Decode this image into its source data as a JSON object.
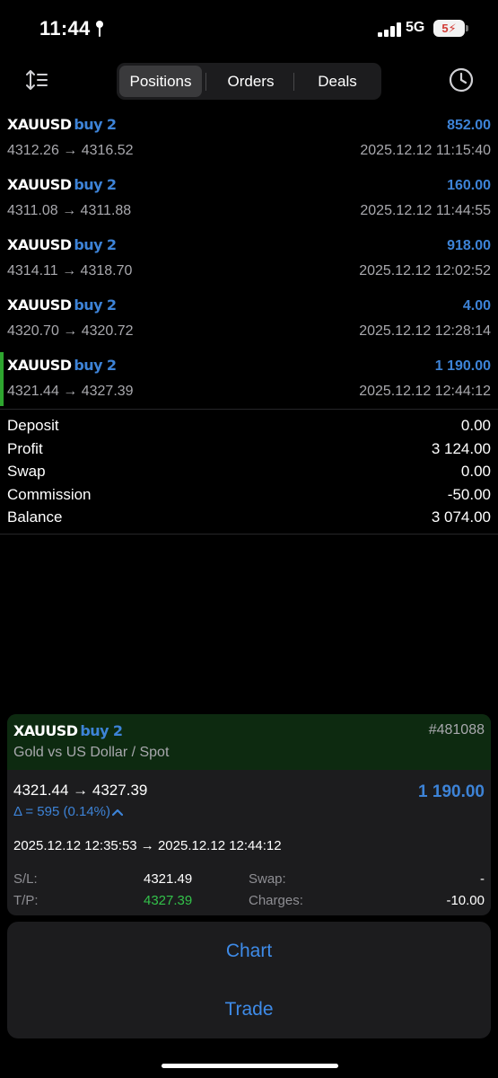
{
  "status_bar": {
    "time": "11:44",
    "network": "5G",
    "battery": "5"
  },
  "tabs": [
    {
      "label": "Positions",
      "active": true
    },
    {
      "label": "Orders",
      "active": false
    },
    {
      "label": "Deals",
      "active": false
    }
  ],
  "positions": [
    {
      "symbol": "XAUUSD",
      "side": "buy 2",
      "prices": "4312.26 → 4316.52",
      "profit": "852.00",
      "time": "2025.12.12 11:15:40"
    },
    {
      "symbol": "XAUUSD",
      "side": "buy 2",
      "prices": "4311.08 → 4311.88",
      "profit": "160.00",
      "time": "2025.12.12 11:44:55"
    },
    {
      "symbol": "XAUUSD",
      "side": "buy 2",
      "prices": "4314.11 → 4318.70",
      "profit": "918.00",
      "time": "2025.12.12 12:02:52"
    },
    {
      "symbol": "XAUUSD",
      "side": "buy 2",
      "prices": "4320.70 → 4320.72",
      "profit": "4.00",
      "time": "2025.12.12 12:28:14"
    },
    {
      "symbol": "XAUUSD",
      "side": "buy 2",
      "prices": "4321.44 → 4327.39",
      "profit": "1 190.00",
      "time": "2025.12.12 12:44:12"
    }
  ],
  "summary": [
    {
      "label": "Deposit",
      "value": "0.00"
    },
    {
      "label": "Profit",
      "value": "3 124.00"
    },
    {
      "label": "Swap",
      "value": "0.00"
    },
    {
      "label": "Commission",
      "value": "-50.00"
    },
    {
      "label": "Balance",
      "value": "3 074.00"
    }
  ],
  "detail": {
    "symbol": "XAUUSD",
    "side": "buy 2",
    "ticket": "#481088",
    "description": "Gold vs US Dollar / Spot",
    "prices": "4321.44 → 4327.39",
    "profit": "1 190.00",
    "delta": "Δ = 595 (0.14%)",
    "times": "2025.12.12 12:35:53 → 2025.12.12 12:44:12",
    "sl_label": "S/L:",
    "sl_value": "4321.49",
    "tp_label": "T/P:",
    "tp_value": "4327.39",
    "swap_label": "Swap:",
    "swap_value": "-",
    "charges_label": "Charges:",
    "charges_value": "-10.00"
  },
  "actions": {
    "chart": "Chart",
    "trade": "Trade"
  },
  "colors": {
    "accent": "#3d83d7",
    "green": "#2ea52f",
    "tp_green": "#33c14a",
    "card_header": "#0d2a10"
  }
}
